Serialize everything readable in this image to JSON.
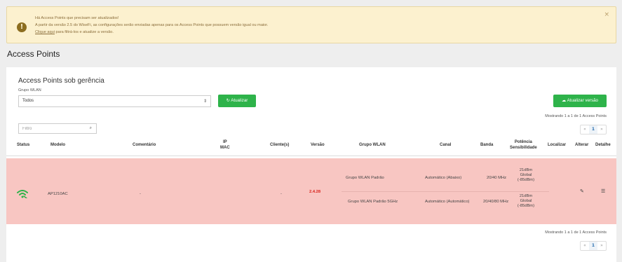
{
  "alert": {
    "icon": "exclamation-icon",
    "line1": "Há Access Points que precisam ser atualizados!",
    "line2": "A partir da versão 2.5 do WiseFi, as configurações serão enviadas apenas para os Access Points que possuem versão igual ou maior.",
    "link_text": "Clique aqui",
    "line3_rest": " para filtrá-los e atualize a versão.",
    "close": "×"
  },
  "page_title": "Access Points",
  "panel": {
    "title": "Access Points sob gerência",
    "group_label": "Grupo WLAN",
    "group_value": "Todos",
    "refresh_button": "Atualizar",
    "update_button": "Atualizar versão",
    "filter_placeholder": "Filtro",
    "showing_top": "Mostrando 1 a 1 de 1 Access Points",
    "showing_bottom": "Mostrando 1 a 1 de 1 Access Points",
    "pager": {
      "prev": "«",
      "page": "1",
      "next": "»"
    }
  },
  "table": {
    "headers": {
      "status": "Status",
      "modelo": "Modelo",
      "comentario": "Comentário",
      "ip": "IP",
      "mac": "MAC",
      "clientes": "Cliente(s)",
      "versao": "Versão",
      "grupo": "Grupo WLAN",
      "canal": "Canal",
      "banda": "Banda",
      "potencia": "Potência",
      "sensibilidade": "Sensibilidade",
      "localizar": "Localizar",
      "alterar": "Alterar",
      "detalhe": "Detalhe"
    },
    "row": {
      "status_icon": "wifi-icon",
      "status_color": "#2eb34a",
      "modelo": "AP1210AC",
      "comentario": "-",
      "clientes": "-",
      "versao": "2.4.28",
      "versao_color": "#d9231c",
      "row_color": "#f8c6c2",
      "subrows": [
        {
          "grupo": "Grupo WLAN Padrão",
          "canal": "Automático (Abaixo)",
          "banda": "20/40 MHz",
          "pot1": "21dBm",
          "pot2": "Global",
          "pot3": "(-85dBm)"
        },
        {
          "grupo": "Grupo WLAN Padrão 5GHz",
          "canal": "Automático (Automático)",
          "banda": "20/40/80 MHz",
          "pot1": "21dBm",
          "pot2": "Global",
          "pot3": "(-85dBm)"
        }
      ]
    }
  }
}
